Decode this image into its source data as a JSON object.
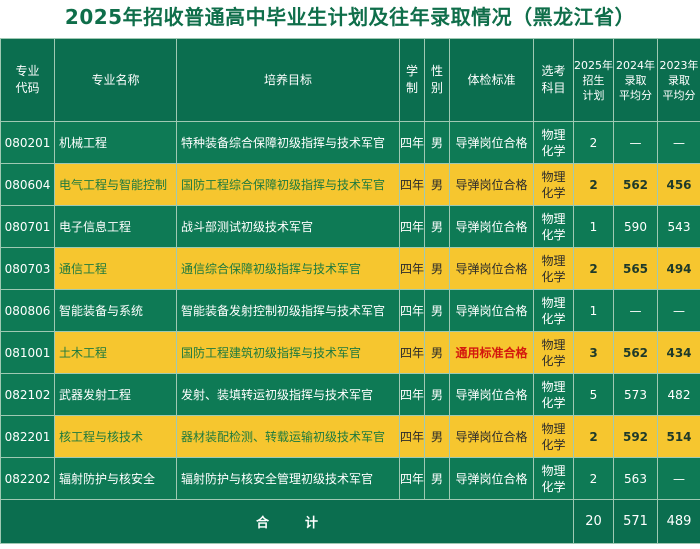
{
  "title": "2025年招收普通高中毕业生计划及往年录取情况（黑龙江省）",
  "headers": {
    "code": "专业\n代码",
    "major": "专业名称",
    "goal": "培养目标",
    "duration": "学\n制",
    "gender": "性\n别",
    "health": "体检标准",
    "subject": "选考\n科目",
    "plan2025": "2025年\n招生\n计划",
    "score2024": "2024年\n录取\n平均分",
    "score2023": "2023年\n录取\n平均分"
  },
  "rows": [
    {
      "code": "080201",
      "major": "机械工程",
      "goal": "特种装备综合保障初级指挥与技术军官",
      "duration": "四年",
      "gender": "男",
      "health": "导弹岗位合格",
      "subject": "物理\n化学",
      "plan": "2",
      "s2024": "—",
      "s2023": "—",
      "style": "green",
      "health_red": false
    },
    {
      "code": "080604",
      "major": "电气工程与智能控制",
      "goal": "国防工程综合保障初级指挥与技术军官",
      "duration": "四年",
      "gender": "男",
      "health": "导弹岗位合格",
      "subject": "物理\n化学",
      "plan": "2",
      "s2024": "562",
      "s2023": "456",
      "style": "yellow",
      "health_red": false
    },
    {
      "code": "080701",
      "major": "电子信息工程",
      "goal": "战斗部测试初级技术军官",
      "duration": "四年",
      "gender": "男",
      "health": "导弹岗位合格",
      "subject": "物理\n化学",
      "plan": "1",
      "s2024": "590",
      "s2023": "543",
      "style": "green",
      "health_red": false
    },
    {
      "code": "080703",
      "major": "通信工程",
      "goal": "通信综合保障初级指挥与技术军官",
      "duration": "四年",
      "gender": "男",
      "health": "导弹岗位合格",
      "subject": "物理\n化学",
      "plan": "2",
      "s2024": "565",
      "s2023": "494",
      "style": "yellow",
      "health_red": false
    },
    {
      "code": "080806",
      "major": "智能装备与系统",
      "goal": "智能装备发射控制初级指挥与技术军官",
      "duration": "四年",
      "gender": "男",
      "health": "导弹岗位合格",
      "subject": "物理\n化学",
      "plan": "1",
      "s2024": "—",
      "s2023": "—",
      "style": "green",
      "health_red": false
    },
    {
      "code": "081001",
      "major": "土木工程",
      "goal": "国防工程建筑初级指挥与技术军官",
      "duration": "四年",
      "gender": "男",
      "health": "通用标准合格",
      "subject": "物理\n化学",
      "plan": "3",
      "s2024": "562",
      "s2023": "434",
      "style": "yellow",
      "health_red": true
    },
    {
      "code": "082102",
      "major": "武器发射工程",
      "goal": "发射、装填转运初级指挥与技术军官",
      "duration": "四年",
      "gender": "男",
      "health": "导弹岗位合格",
      "subject": "物理\n化学",
      "plan": "5",
      "s2024": "573",
      "s2023": "482",
      "style": "green",
      "health_red": false
    },
    {
      "code": "082201",
      "major": "核工程与核技术",
      "goal": "器材装配检测、转载运输初级技术军官",
      "duration": "四年",
      "gender": "男",
      "health": "导弹岗位合格",
      "subject": "物理\n化学",
      "plan": "2",
      "s2024": "592",
      "s2023": "514",
      "style": "yellow",
      "health_red": false
    },
    {
      "code": "082202",
      "major": "辐射防护与核安全",
      "goal": "辐射防护与核安全管理初级技术军官",
      "duration": "四年",
      "gender": "男",
      "health": "导弹岗位合格",
      "subject": "物理\n化学",
      "plan": "2",
      "s2024": "563",
      "s2023": "—",
      "style": "green",
      "health_red": false
    }
  ],
  "total": {
    "label": "合计",
    "plan": "20",
    "s2024": "571",
    "s2023": "489"
  },
  "colors": {
    "header_green": "#0b6e4f",
    "row_green": "#0e7a55",
    "row_yellow": "#f6c62f",
    "health_red": "#d4180e",
    "title_green": "#0f6e4a"
  }
}
